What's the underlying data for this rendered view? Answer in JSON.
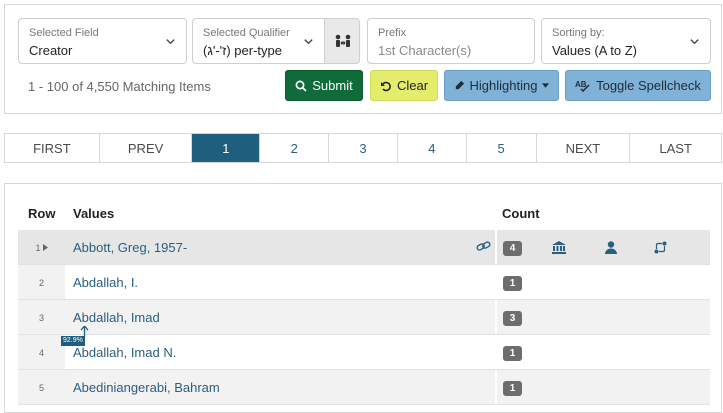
{
  "filters": {
    "field": {
      "label": "Selected Field",
      "value": "Creator"
    },
    "qualifier": {
      "label": "Selected Qualifier",
      "value": "(ז'-'ג) per-type"
    },
    "prefix": {
      "label": "Prefix",
      "placeholder": "1st Character(s)"
    },
    "sort": {
      "label": "Sorting by:",
      "value": "Values (A to Z)"
    }
  },
  "match_count": "1 - 100 of 4,550 Matching Items",
  "buttons": {
    "submit": "Submit",
    "clear": "Clear",
    "highlighting": "Highlighting",
    "spellcheck": "Toggle Spellcheck"
  },
  "pager": {
    "first": "FIRST",
    "prev": "PREV",
    "pages": [
      "1",
      "2",
      "3",
      "4",
      "5"
    ],
    "next": "NEXT",
    "last": "LAST",
    "active_page": "1"
  },
  "table": {
    "headers": {
      "row": "Row",
      "values": "Values",
      "count": "Count"
    },
    "rows": [
      {
        "row": "1",
        "value": "Abbott, Greg, 1957-",
        "count": "4"
      },
      {
        "row": "2",
        "value": "Abdallah, I.",
        "count": "1"
      },
      {
        "row": "3",
        "value": "Abdallah, Imad",
        "count": "3"
      },
      {
        "row": "4",
        "value": "Abdallah, Imad N.",
        "count": "1"
      },
      {
        "row": "5",
        "value": "Abediniangerabi, Bahram",
        "count": "1"
      }
    ]
  },
  "overlay_percent": "92.9%",
  "colors": {
    "accent": "#1f5f7d",
    "submit": "#0f6b3a",
    "clear": "#e4ed6b",
    "toolbar": "#7fb2d6",
    "link": "#2a5f80"
  }
}
